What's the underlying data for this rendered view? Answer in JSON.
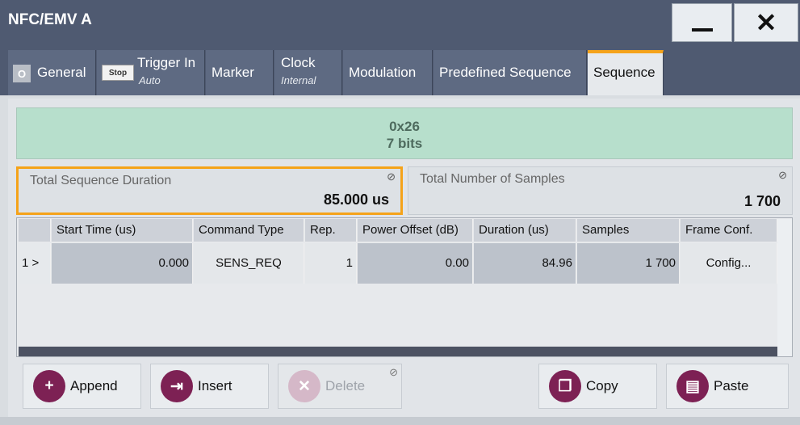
{
  "window": {
    "title": "NFC/EMV A",
    "minimize_label": "minimize",
    "close_symbol": "✕"
  },
  "tabs": [
    {
      "label": "General",
      "badge": "O"
    },
    {
      "label": "Trigger In",
      "badge": "Stop",
      "sub": "Auto"
    },
    {
      "label": "Marker"
    },
    {
      "label": "Clock",
      "sub": "Internal"
    },
    {
      "label": "Modulation"
    },
    {
      "label": "Predefined Sequence"
    },
    {
      "label": "Sequence",
      "active": true
    }
  ],
  "frame_display": {
    "line1": "0x26",
    "line2": "7 bits"
  },
  "total_duration": {
    "label": "Total Sequence Duration",
    "value": "85.000 us"
  },
  "total_samples": {
    "label": "Total Number of Samples",
    "value": "1 700"
  },
  "table": {
    "headers": [
      "Start Time (us)",
      "Command Type",
      "Rep.",
      "Power Offset (dB)",
      "Duration (us)",
      "Samples",
      "Frame Conf."
    ],
    "rows": [
      {
        "index": "1 >",
        "start_time": "0.000",
        "command_type": "SENS_REQ",
        "rep": "1",
        "power_offset": "0.00",
        "duration": "84.96",
        "samples": "1 700",
        "frame_conf": "Config..."
      }
    ]
  },
  "buttons": {
    "append": "Append",
    "insert": "Insert",
    "delete": "Delete",
    "copy": "Copy",
    "paste": "Paste"
  },
  "colors": {
    "accent": "#f5a31a",
    "titlebar": "#4f5a71",
    "icon": "#7d2154"
  }
}
